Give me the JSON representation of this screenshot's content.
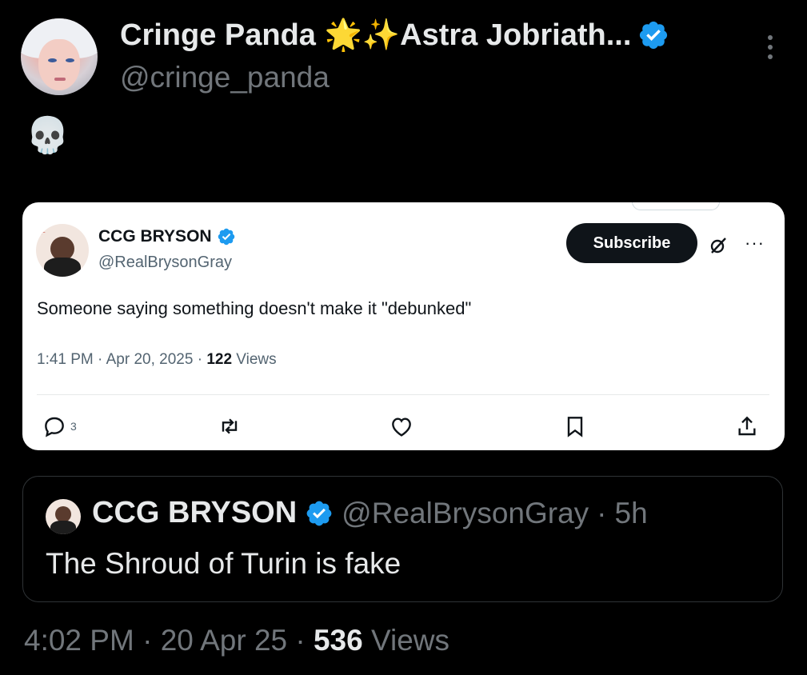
{
  "post": {
    "display_name": "Cringe Panda 🌟✨Astra Jobriath...",
    "handle": "@cringe_panda",
    "body": "💀",
    "timestamp": "4:02 PM",
    "date": "20 Apr 25",
    "views_count": "536",
    "views_label": "Views"
  },
  "screenshot": {
    "display_name": "CCG BRYSON",
    "handle": "@RealBrysonGray",
    "subscribe_label": "Subscribe",
    "text": "Someone saying something doesn't make it \"debunked\"",
    "time": "1:41 PM",
    "date": "Apr 20, 2025",
    "views_count": "122",
    "views_label": "Views",
    "reply_count": "3",
    "icons": [
      "reply-icon",
      "retweet-icon",
      "like-icon",
      "bookmark-icon",
      "share-icon"
    ]
  },
  "quoted": {
    "display_name": "CCG BRYSON",
    "handle": "@RealBrysonGray",
    "age": "5h",
    "text": "The Shroud of Turin is fake"
  },
  "colors": {
    "background": "#000000",
    "verified": "#1d9bf0",
    "muted": "#71767b"
  }
}
